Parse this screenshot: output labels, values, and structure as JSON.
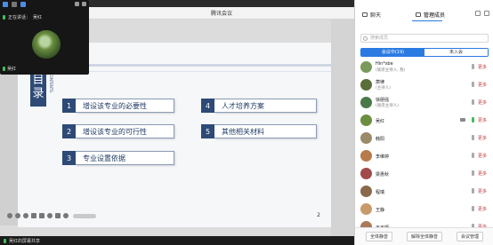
{
  "window": {
    "title": "腾讯会议"
  },
  "video_tile": {
    "speaking_prefix": "正在讲话：",
    "speaking_name": "吴红",
    "participant_name": "吴红"
  },
  "slide": {
    "heading": "目录",
    "heading_sub": "CONTENTS",
    "page": "2",
    "items": [
      {
        "num": "1",
        "label": "增设该专业的必要性"
      },
      {
        "num": "2",
        "label": "增设该专业的可行性"
      },
      {
        "num": "3",
        "label": "专业设置依据"
      },
      {
        "num": "4",
        "label": "人才培养方案"
      },
      {
        "num": "5",
        "label": "其他相关材料"
      }
    ]
  },
  "status_bar": {
    "text": "吴红的屏幕共享"
  },
  "panel": {
    "tabs": [
      {
        "label": "聊天"
      },
      {
        "label": "管理成员"
      }
    ],
    "search_placeholder": "搜索成员",
    "segments": {
      "in_meeting": "会议中(19)",
      "not_joined": "未入会"
    },
    "members": [
      {
        "name": "Hin*sbe",
        "role": "(联席主持人, 我)",
        "avatar": "#7a9a5a",
        "mic": "grey",
        "more": "更多"
      },
      {
        "name": "萧律",
        "role": "(主持人)",
        "avatar": "#5a6e3a",
        "mic": "grey",
        "more": "更多"
      },
      {
        "name": "徐朋强",
        "role": "(联席主持人)",
        "avatar": "#4a7a4a",
        "mic": "grey",
        "more": "更多"
      },
      {
        "name": "吴红",
        "role": "",
        "avatar": "#6b8e3f",
        "mic": "green",
        "cam": true,
        "more": "更多"
      },
      {
        "name": "韩阳",
        "role": "",
        "avatar": "#9a8a6a",
        "mic": "grey",
        "more": "更多"
      },
      {
        "name": "李维婷",
        "role": "",
        "avatar": "#b87a4a",
        "mic": "grey",
        "more": "更多"
      },
      {
        "name": "梁惠秋",
        "role": "",
        "avatar": "#a04a4a",
        "mic": "grey",
        "more": "更多"
      },
      {
        "name": "程瑞",
        "role": "",
        "avatar": "#8a6a4a",
        "mic": "grey",
        "more": "更多"
      },
      {
        "name": "王静",
        "role": "",
        "avatar": "#c89a6a",
        "mic": "grey",
        "more": "更多"
      },
      {
        "name": "王玉妍",
        "role": "",
        "avatar": "#aa7a5a",
        "mic": "grey",
        "more": "更多"
      }
    ],
    "bottom_buttons": [
      "全体静音",
      "解除全体静音",
      "会议管理"
    ]
  }
}
